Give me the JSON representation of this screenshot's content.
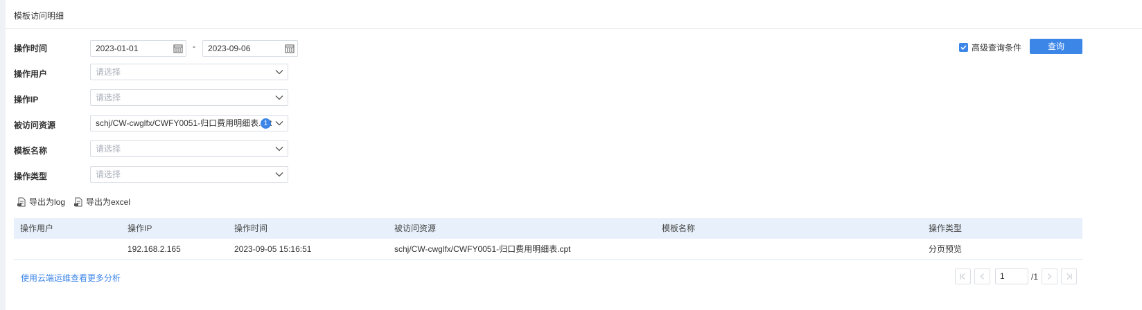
{
  "panel": {
    "title": "模板访问明细"
  },
  "form": {
    "op_time": {
      "label": "操作时间",
      "start": "2023-01-01",
      "end": "2023-09-06",
      "separator": "-"
    },
    "op_user": {
      "label": "操作用户",
      "placeholder": "请选择"
    },
    "op_ip": {
      "label": "操作IP",
      "placeholder": "请选择"
    },
    "resource": {
      "label": "被访问资源",
      "value": "schj/CW-cwglfx/CWFY0051-归口费用明细表.cpt",
      "badge": "1"
    },
    "template_name": {
      "label": "模板名称",
      "placeholder": "请选择"
    },
    "op_type": {
      "label": "操作类型",
      "placeholder": "请选择"
    }
  },
  "advanced": {
    "label": "高级查询条件",
    "checked": true
  },
  "query_button": "查询",
  "export": {
    "log": "导出为log",
    "excel": "导出为excel"
  },
  "table": {
    "headers": [
      "操作用户",
      "操作IP",
      "操作时间",
      "被访问资源",
      "模板名称",
      "操作类型"
    ],
    "rows": [
      [
        "",
        "192.168.2.165",
        "2023-09-05 15:16:51",
        "schj/CW-cwglfx/CWFY0051-归口费用明细表.cpt",
        "",
        "分页预览"
      ]
    ]
  },
  "footer": {
    "cloud_link": "使用云端运维查看更多分析"
  },
  "pager": {
    "current": "1",
    "total": "/1"
  },
  "colors": {
    "accent": "#3c86e8",
    "header_bg": "#e8f1fb"
  }
}
